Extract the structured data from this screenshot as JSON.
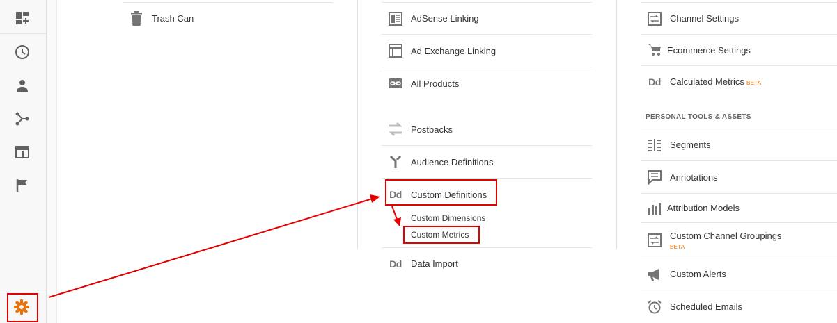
{
  "sidebar": {
    "items": [
      {
        "icon": "customize-dashboard-icon"
      },
      {
        "icon": "clock-icon"
      },
      {
        "icon": "person-icon"
      },
      {
        "icon": "acquisition-icon"
      },
      {
        "icon": "behavior-icon"
      },
      {
        "icon": "flag-icon"
      }
    ],
    "admin_icon": "gear-icon",
    "accent_color": "#e8710a"
  },
  "column1": {
    "items": [
      {
        "label": "Trash Can",
        "icon": "trash-icon"
      }
    ]
  },
  "column2": {
    "items": [
      {
        "label": "AdSense Linking",
        "icon": "adsense-icon"
      },
      {
        "label": "Ad Exchange Linking",
        "icon": "ad-exchange-icon"
      },
      {
        "label": "All Products",
        "icon": "link-icon"
      },
      {
        "label": "Postbacks",
        "icon": "postbacks-icon"
      },
      {
        "label": "Audience Definitions",
        "icon": "audience-icon"
      },
      {
        "label": "Custom Definitions",
        "icon": "dd-icon",
        "icon_text": "Dd"
      },
      {
        "label": "Data Import",
        "icon": "dd-icon",
        "icon_text": "Dd"
      }
    ],
    "sub_items": [
      "Custom Dimensions",
      "Custom Metrics"
    ]
  },
  "column3": {
    "items": [
      {
        "label": "Channel Settings",
        "icon": "channel-icon"
      },
      {
        "label": "Ecommerce Settings",
        "icon": "cart-icon"
      },
      {
        "label": "Calculated Metrics",
        "badge": "BETA",
        "icon": "dd-icon",
        "icon_text": "Dd"
      }
    ],
    "section_title": "PERSONAL TOOLS & ASSETS",
    "personal_items": [
      {
        "label": "Segments",
        "icon": "segments-icon"
      },
      {
        "label": "Annotations",
        "icon": "annotations-icon"
      },
      {
        "label": "Attribution Models",
        "icon": "attribution-icon"
      },
      {
        "label": "Custom Channel Groupings",
        "badge": "BETA",
        "icon": "channel-icon"
      },
      {
        "label": "Custom Alerts",
        "icon": "megaphone-icon"
      },
      {
        "label": "Scheduled Emails",
        "icon": "alarm-icon"
      }
    ]
  },
  "annotations": {
    "highlight_color": "#e50000"
  }
}
